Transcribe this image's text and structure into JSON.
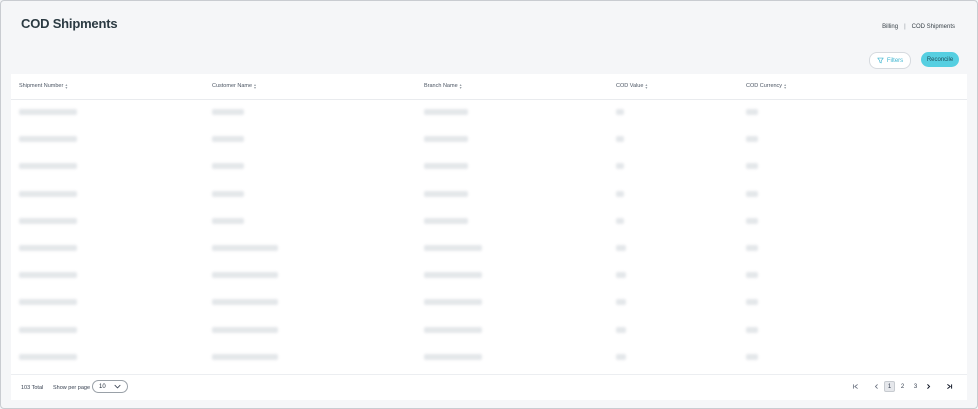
{
  "page": {
    "title": "COD Shipments",
    "breadcrumb": [
      "Billing",
      "|",
      "COD Shipments"
    ]
  },
  "actions": {
    "filters_label": "Filters",
    "reconcile_label": "Reconcile"
  },
  "table": {
    "columns": [
      "Shipment Number",
      "Customer Name",
      "Branch Name",
      "COD Value",
      "COD Currency"
    ],
    "row_count_visible": 10,
    "rows_note": "cell values are blurred/unreadable"
  },
  "footer": {
    "total_text": "103 Total",
    "per_page_label": "Show per page",
    "per_page_value": "10",
    "pages": [
      "1",
      "2",
      "3"
    ],
    "current_page": "1"
  },
  "colors": {
    "accent": "#56cfe1",
    "filter_text": "#3bb4d0"
  }
}
